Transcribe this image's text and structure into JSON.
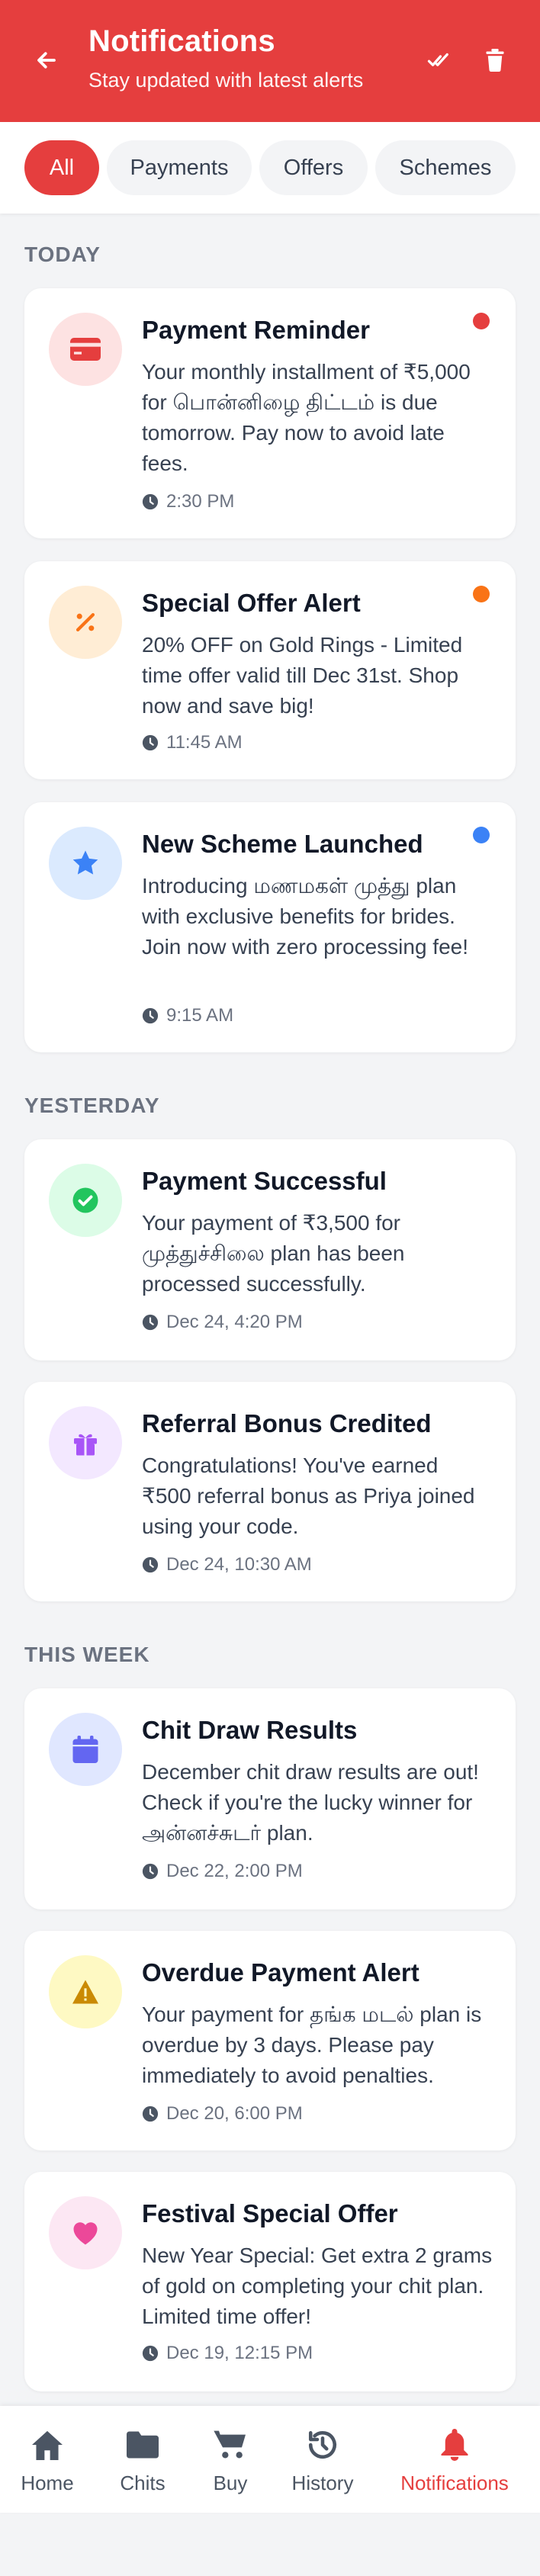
{
  "header": {
    "title": "Notifications",
    "subtitle": "Stay updated with latest alerts",
    "color": "#e53e3e"
  },
  "filters": [
    {
      "label": "All",
      "active": true
    },
    {
      "label": "Payments",
      "active": false
    },
    {
      "label": "Offers",
      "active": false
    },
    {
      "label": "Schemes",
      "active": false
    }
  ],
  "sections": {
    "today": "TODAY",
    "yesterday": "YESTERDAY",
    "this_week": "THIS WEEK"
  },
  "notifications": [
    {
      "title": "Payment Reminder",
      "message": "Your monthly installment of ₹5,000 for பொன்னிழை திட்டம் is due tomorrow. Pay now to avoid late fees.",
      "time": "2:30 PM",
      "icon": "credit-card-icon",
      "unread": true,
      "dot_color": "#e53e3e"
    },
    {
      "title": "Special Offer Alert",
      "message": "20% OFF on Gold Rings - Limited time offer valid till Dec 31st. Shop now and save big!",
      "time": "11:45 AM",
      "icon": "percent-icon",
      "unread": true,
      "dot_color": "#f97316"
    },
    {
      "title": "New Scheme Launched",
      "message": "Introducing மணமகள் முத்து plan with exclusive benefits for brides. Join now with zero processing fee!",
      "time": "9:15 AM",
      "icon": "star-icon",
      "unread": true,
      "dot_color": "#3b82f6"
    },
    {
      "title": "Payment Successful",
      "message": "Your payment of ₹3,500 for முத்துச்சிலை plan has been processed successfully.",
      "time": "Dec 24, 4:20 PM",
      "icon": "check-circle-icon",
      "unread": false
    },
    {
      "title": "Referral Bonus Credited",
      "message": "Congratulations! You've earned ₹500 referral bonus as Priya joined using your code.",
      "time": "Dec 24, 10:30 AM",
      "icon": "gift-icon",
      "unread": false
    },
    {
      "title": "Chit Draw Results",
      "message": "December chit draw results are out! Check if you're the lucky winner for அன்னச்சுடர் plan.",
      "time": "Dec 22, 2:00 PM",
      "icon": "calendar-icon",
      "unread": false
    },
    {
      "title": "Overdue Payment Alert",
      "message": "Your payment for தங்க மடல் plan is overdue by 3 days. Please pay immediately to avoid penalties.",
      "time": "Dec 20, 6:00 PM",
      "icon": "warning-icon",
      "unread": false
    },
    {
      "title": "Festival Special Offer",
      "message": "New Year Special: Get extra 2 grams of gold on completing your chit plan. Limited time offer!",
      "time": "Dec 19, 12:15 PM",
      "icon": "heart-icon",
      "unread": false
    }
  ],
  "nav": [
    {
      "label": "Home",
      "icon": "home-icon"
    },
    {
      "label": "Chits",
      "icon": "folder-icon"
    },
    {
      "label": "Buy",
      "icon": "cart-icon"
    },
    {
      "label": "History",
      "icon": "history-icon"
    },
    {
      "label": "Notifications",
      "icon": "bell-icon",
      "active": true
    }
  ]
}
